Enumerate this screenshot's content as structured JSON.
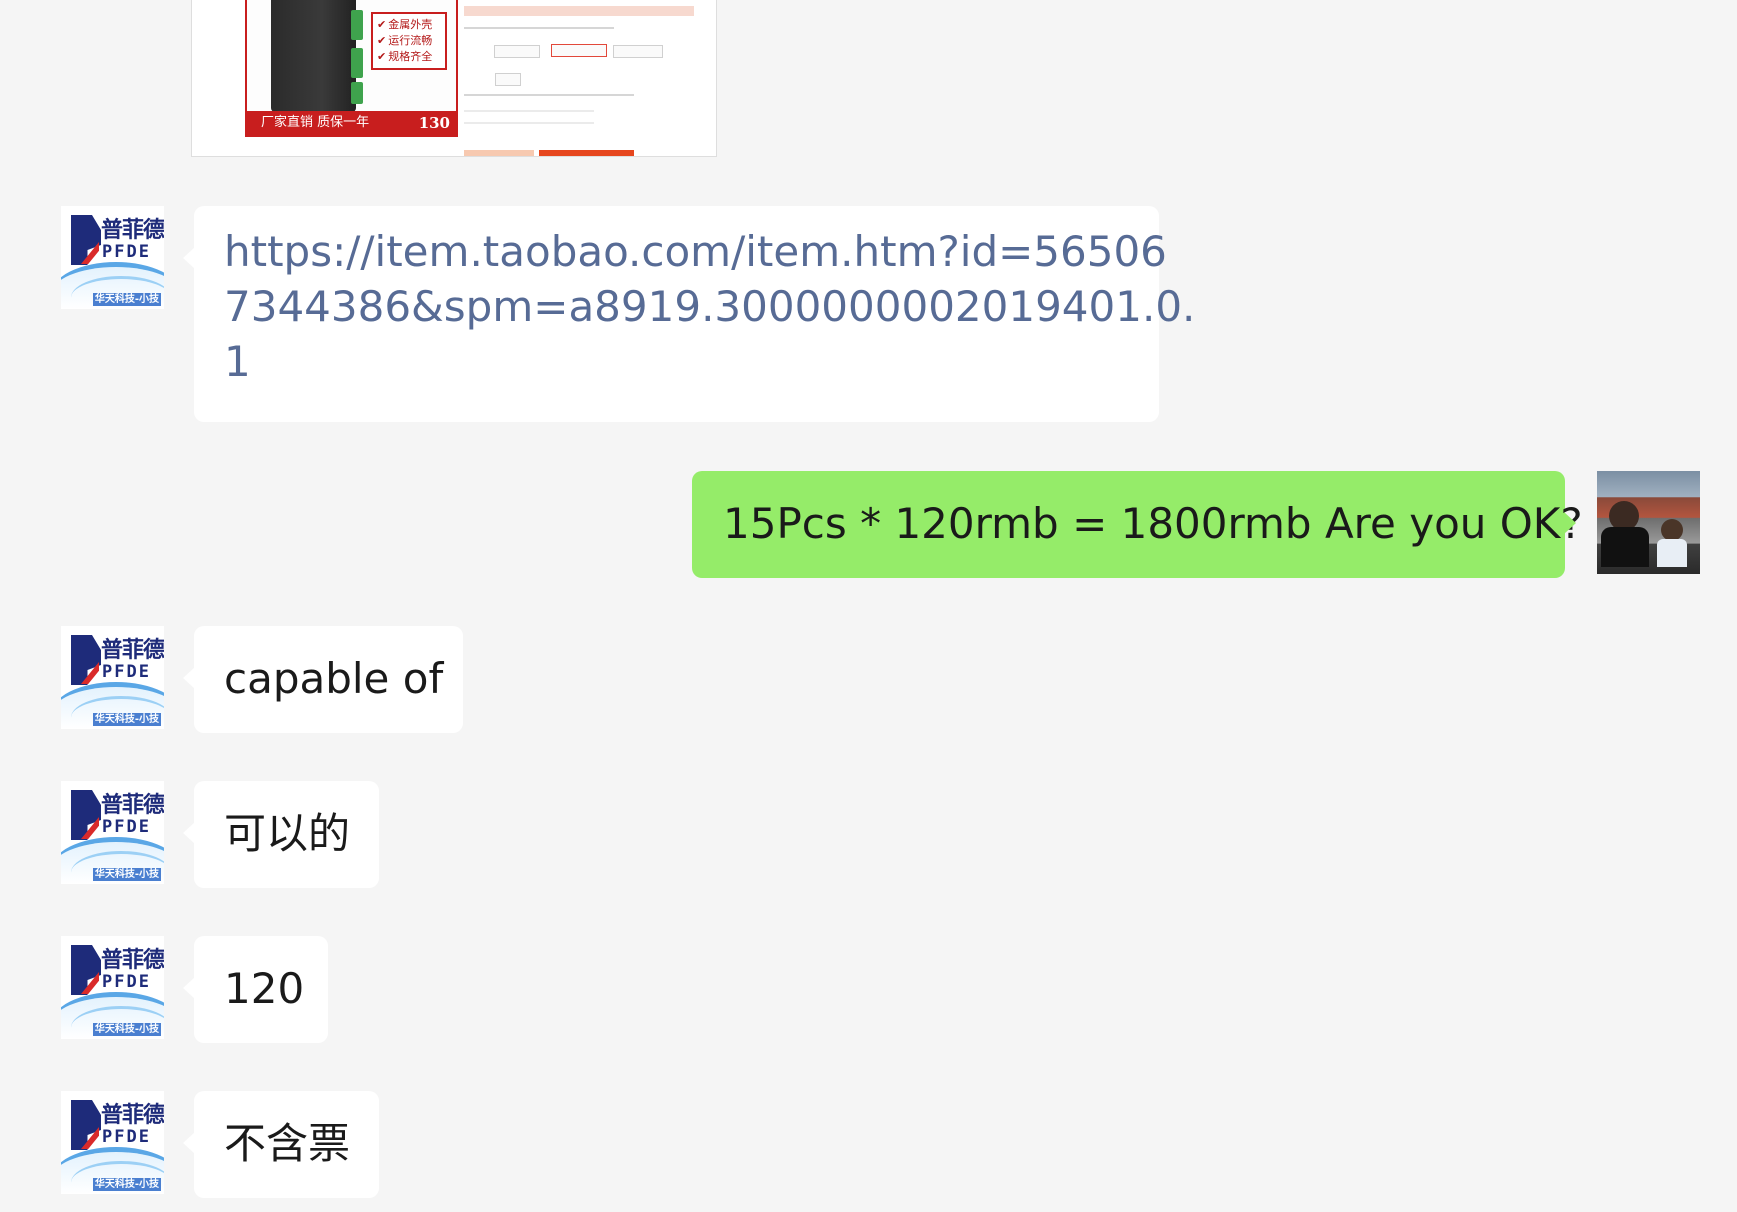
{
  "product_card": {
    "features": [
      "金属外壳",
      "运行流畅",
      "规格齐全"
    ],
    "promo_text": "厂家直销 质保一年",
    "price": "130"
  },
  "contact": {
    "avatar_name_cn": "普菲德",
    "avatar_name_en": "PFDE",
    "avatar_tag": "华天科技-小技"
  },
  "messages": [
    {
      "sender": "contact",
      "type": "link",
      "lines": [
        "https://item.taobao.com/item.htm?id=56506",
        "7344386&spm=a8919.3000000002019401.0.",
        "1"
      ]
    },
    {
      "sender": "me",
      "type": "text",
      "text": "15Pcs * 120rmb = 1800rmb Are you OK?"
    },
    {
      "sender": "contact",
      "type": "text",
      "text": "capable of"
    },
    {
      "sender": "contact",
      "type": "text",
      "text": "可以的"
    },
    {
      "sender": "contact",
      "type": "text",
      "text": "120"
    },
    {
      "sender": "contact",
      "type": "text",
      "text": "不含票"
    }
  ],
  "colors": {
    "background": "#f5f5f5",
    "incoming_bubble": "#ffffff",
    "outgoing_bubble": "#95ec69",
    "link_text": "#576b95"
  }
}
